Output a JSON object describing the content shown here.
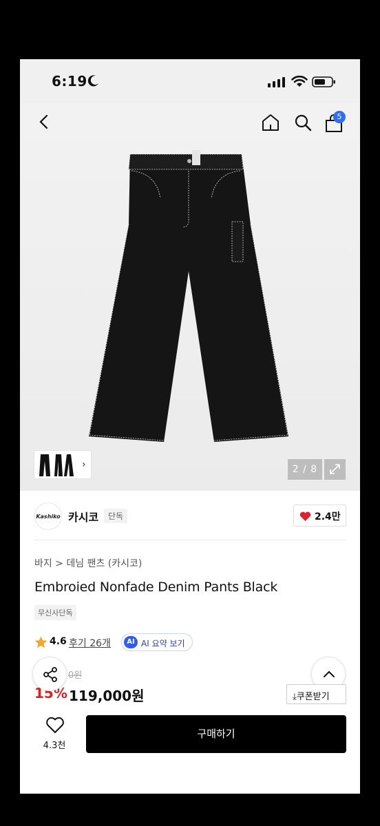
{
  "status_bar": {
    "time": "6:19"
  },
  "nav": {
    "cart_count": "5"
  },
  "gallery": {
    "pager": "2 / 8"
  },
  "brand": {
    "logo_text": "Kashiko",
    "name": "카시코",
    "tag": "단독",
    "likes": "2.4만"
  },
  "breadcrumb": "바지 > 데님 팬츠 (카시코)",
  "product": {
    "title": "Embroied Nonfade Denim Pants Black",
    "tag": "무신사단독",
    "rating": "4.6",
    "review": "후기 26개",
    "ai_badge": "AI",
    "ai_label": "AI 요약 보기",
    "original_price": "0원",
    "discount": "15%",
    "price": "119,000원",
    "coupon": "쿠폰받기"
  },
  "bottom": {
    "wish_count": "4.3천",
    "buy_label": "구매하기"
  },
  "colors": {
    "accent_blue": "#2f6df6",
    "discount_red": "#e02020",
    "heart_red": "#e0202e"
  },
  "icons": [
    "back-icon",
    "home-icon",
    "search-icon",
    "cart-icon",
    "expand-icon",
    "heart-icon",
    "star-icon",
    "share-icon",
    "chevron-up-icon",
    "download-icon"
  ]
}
